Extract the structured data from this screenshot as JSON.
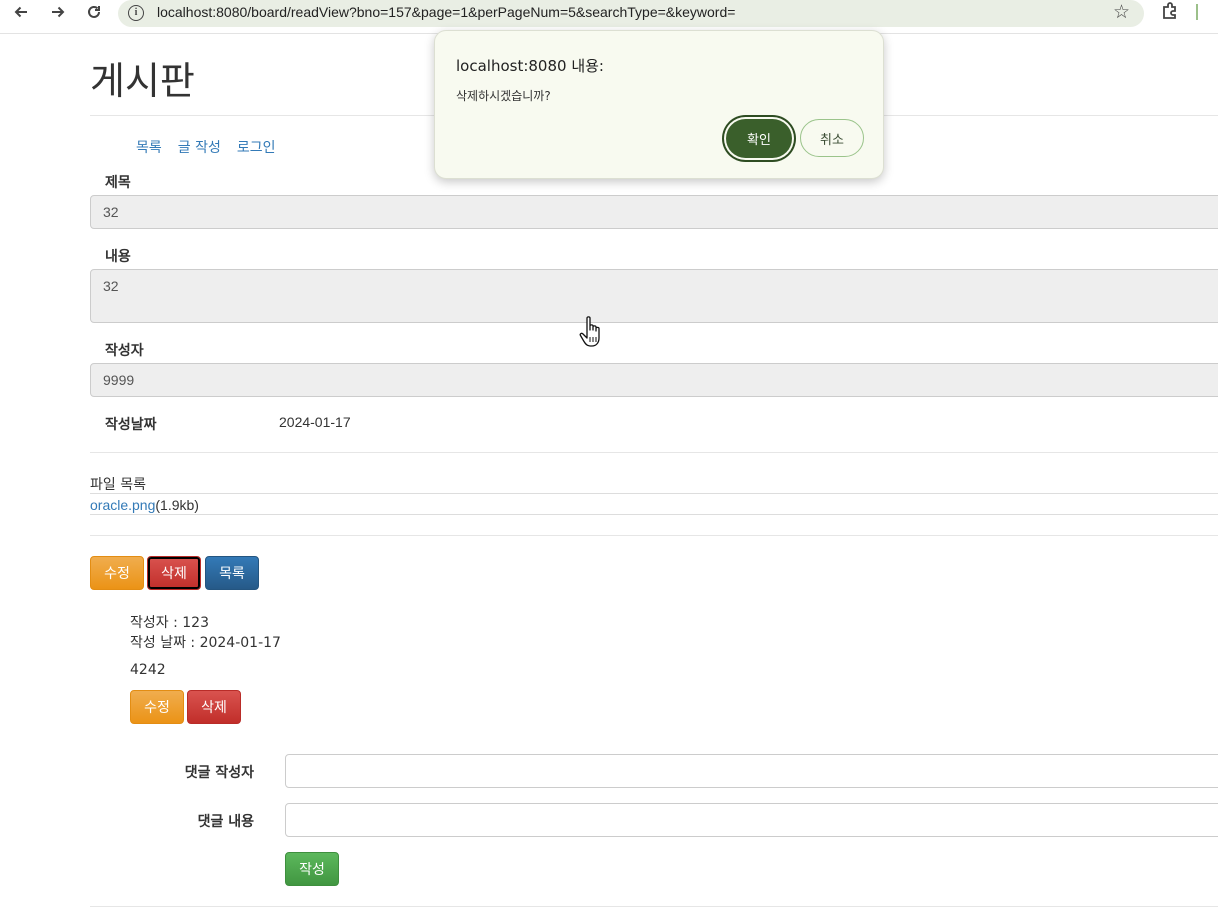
{
  "browser": {
    "url": "localhost:8080/board/readView?bno=157&page=1&perPageNum=5&searchType=&keyword=",
    "back_icon": "arrow-left",
    "forward_icon": "arrow-right",
    "reload_icon": "reload"
  },
  "page": {
    "title": "게시판",
    "links": [
      "목록",
      "글 작성",
      "로그인"
    ]
  },
  "post": {
    "title_label": "제목",
    "title_value": "32",
    "content_label": "내용",
    "content_value": "32",
    "writer_label": "작성자",
    "writer_value": "9999",
    "date_label": "작성날짜",
    "date_value": "2024-01-17"
  },
  "files": {
    "label": "파일 목록",
    "items": [
      {
        "name": "oracle.png",
        "size": "(1.9kb)"
      }
    ]
  },
  "actions": {
    "edit": "수정",
    "delete": "삭제",
    "list": "목록"
  },
  "reply": {
    "writer": "작성자 : 123",
    "date": "작성 날짜 : 2024-01-17",
    "content": "4242",
    "edit": "수정",
    "delete": "삭제"
  },
  "reply_form": {
    "writer_label": "댓글 작성자",
    "content_label": "댓글 내용",
    "submit": "작성"
  },
  "dialog": {
    "title": "localhost:8080 내용:",
    "message": "삭제하시겠습니까?",
    "ok": "확인",
    "cancel": "취소"
  }
}
